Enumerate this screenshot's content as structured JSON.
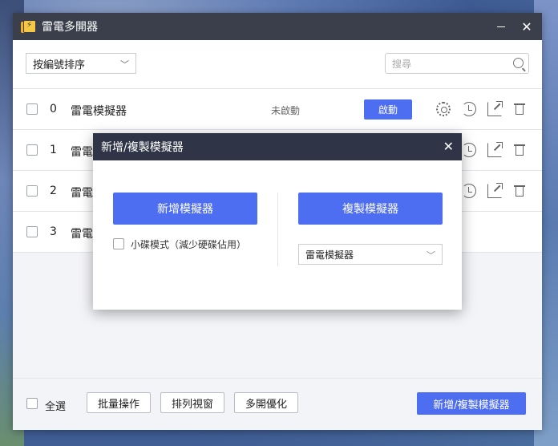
{
  "app": {
    "title": "雷電多開器"
  },
  "toolbar": {
    "sort_label": "按編號排序",
    "search_placeholder": "搜尋"
  },
  "rows": [
    {
      "index": "0",
      "name": "雷電模擬器",
      "status": "未啟動",
      "action": "啟動"
    },
    {
      "index": "1",
      "name": "雷電"
    },
    {
      "index": "2",
      "name": "雷電"
    },
    {
      "index": "3",
      "name": "雷電"
    }
  ],
  "footer": {
    "select_all": "全選",
    "batch": "批量操作",
    "arrange": "排列視窗",
    "optimize": "多開優化",
    "add_copy": "新增/複製模擬器"
  },
  "dialog": {
    "title": "新增/複製模擬器",
    "new_button": "新增模擬器",
    "copy_button": "複製模擬器",
    "small_disk_label": "小碟模式（減少硬碟佔用）",
    "copy_source": "雷電模擬器"
  },
  "colors": {
    "accent": "#4e6ef2",
    "titlebar": "#3a3f4b",
    "dialog_header": "#2f3546"
  }
}
